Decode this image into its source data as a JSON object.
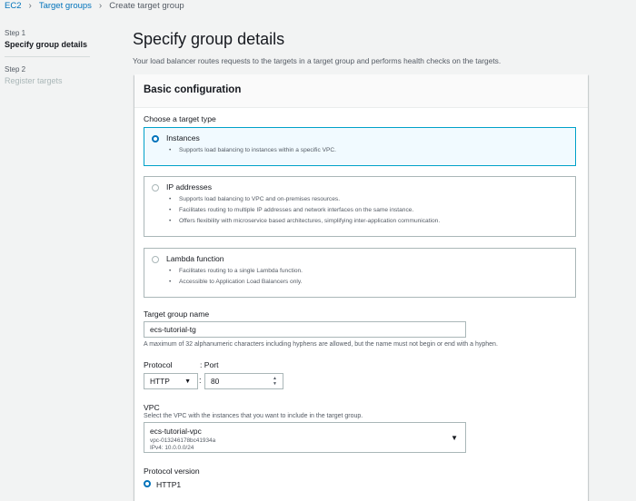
{
  "breadcrumb": {
    "items": [
      "EC2",
      "Target groups",
      "Create target group"
    ]
  },
  "steps": [
    {
      "label": "Step 1",
      "title": "Specify group details",
      "active": true
    },
    {
      "label": "Step 2",
      "title": "Register targets",
      "active": false
    }
  ],
  "page": {
    "title": "Specify group details",
    "description": "Your load balancer routes requests to the targets in a target group and performs health checks on the targets."
  },
  "basic_config": {
    "title": "Basic configuration",
    "target_type_label": "Choose a target type",
    "options": [
      {
        "title": "Instances",
        "selected": true,
        "bullets": [
          "Supports load balancing to instances within a specific VPC."
        ]
      },
      {
        "title": "IP addresses",
        "selected": false,
        "bullets": [
          "Supports load balancing to VPC and on-premises resources.",
          "Facilitates routing to multiple IP addresses and network interfaces on the same instance.",
          "Offers flexibility with microservice based architectures, simplifying inter-application communication."
        ]
      },
      {
        "title": "Lambda function",
        "selected": false,
        "bullets": [
          "Facilitates routing to a single Lambda function.",
          "Accessible to Application Load Balancers only."
        ]
      }
    ],
    "name_label": "Target group name",
    "name_value": "ecs-tutorial-tg",
    "name_hint": "A maximum of 32 alphanumeric characters including hyphens are allowed, but the name must not begin or end with a hyphen.",
    "protocol_label": "Protocol",
    "port_label": ": Port",
    "protocol_value": "HTTP",
    "port_value": "80",
    "vpc_label": "VPC",
    "vpc_hint": "Select the VPC with the instances that you want to include in the target group.",
    "vpc_name": "ecs-tutorial-vpc",
    "vpc_id": "vpc-013246178bc41934a",
    "vpc_ipv4": "IPv4: 10.0.0.0/24",
    "protocol_version_label": "Protocol version",
    "protocol_version_value": "HTTP1"
  },
  "colors": {
    "link": "#0073bb",
    "selected_border": "#00a1c9",
    "selected_bg": "#f1faff"
  }
}
